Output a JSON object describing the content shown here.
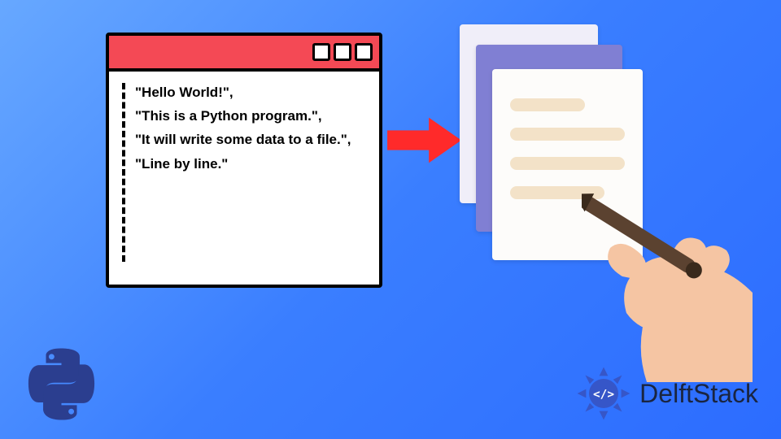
{
  "code": {
    "lines": [
      "\"Hello World!\",",
      "\"This is a Python program.\",",
      "\"It will write some data to a file.\",",
      "\"Line by line.\""
    ]
  },
  "brand": {
    "name": "DelftStack"
  },
  "icons": {
    "python": "python-logo",
    "hand_pen": "hand-writing-icon",
    "arrow": "arrow-right-icon",
    "ds_logo": "delftstack-logo"
  },
  "colors": {
    "accent_red": "#f44955",
    "arrow_red": "#ff2a2a",
    "paper_purple": "#807fd3",
    "line_beige": "#f3e2c8",
    "ds_blue": "#3656c8"
  }
}
